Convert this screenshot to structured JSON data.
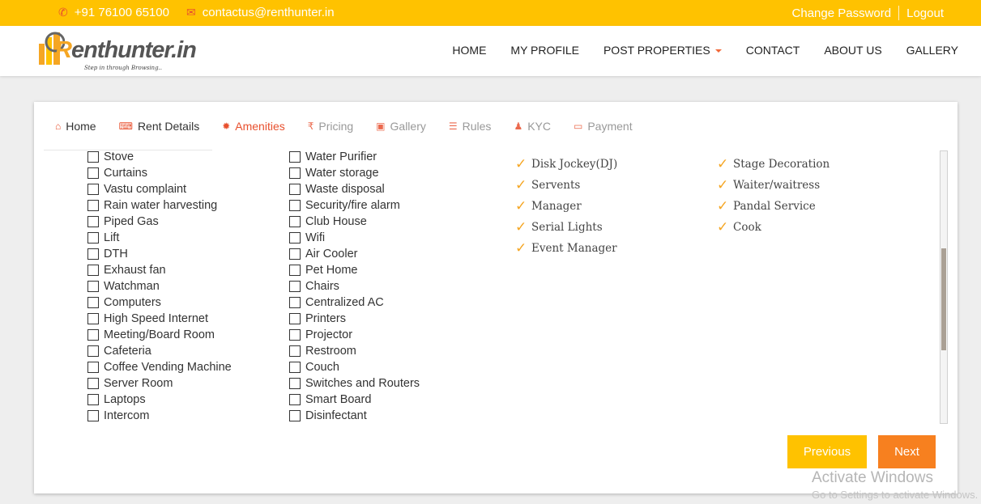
{
  "topbar": {
    "phone": "+91 76100 65100",
    "email": "contactus@renthunter.in",
    "change_password": "Change Password",
    "logout": "Logout",
    "phone_icon": "phone-icon",
    "email_icon": "envelope-icon"
  },
  "logo": {
    "r": "R",
    "text": "enthunter.in",
    "tagline": "Step in through Browsing.."
  },
  "nav": {
    "home": "HOME",
    "my_profile": "MY PROFILE",
    "post_properties": "POST PROPERTIES",
    "contact": "CONTACT",
    "about_us": "ABOUT US",
    "gallery": "GALLERY"
  },
  "tabs": [
    {
      "label": "Home",
      "icon": "home-icon",
      "glyph": "⌂"
    },
    {
      "label": "Rent Details",
      "icon": "keyboard-icon",
      "glyph": "⌨"
    },
    {
      "label": "Amenities",
      "icon": "asterisk-icon",
      "glyph": "✹"
    },
    {
      "label": "Pricing",
      "icon": "rupee-icon",
      "glyph": "₹"
    },
    {
      "label": "Gallery",
      "icon": "image-icon",
      "glyph": "▣"
    },
    {
      "label": "Rules",
      "icon": "list-icon",
      "glyph": "☰"
    },
    {
      "label": "KYC",
      "icon": "user-icon",
      "glyph": "♟"
    },
    {
      "label": "Payment",
      "icon": "money-icon",
      "glyph": "▭"
    }
  ],
  "amenities_col1": [
    "Stove",
    "Curtains",
    "Vastu complaint",
    "Rain water harvesting",
    "Piped Gas",
    "Lift",
    "DTH",
    "Exhaust fan",
    "Watchman",
    "Computers",
    "High Speed Internet",
    "Meeting/Board Room",
    "Cafeteria",
    "Coffee Vending Machine",
    "Server Room",
    "Laptops",
    "Intercom"
  ],
  "amenities_col2": [
    "Water Purifier",
    "Water storage",
    "Waste disposal",
    "Security/fire alarm",
    "Club House",
    "Wifi",
    "Air Cooler",
    "Pet Home",
    "Chairs",
    "Centralized AC",
    "Printers",
    "Projector",
    "Restroom",
    "Couch",
    "Switches and Routers",
    "Smart Board",
    "Disinfectant"
  ],
  "services_col1": [
    "Disk Jockey(DJ)",
    "Servents",
    "Manager",
    "Serial Lights",
    "Event Manager"
  ],
  "services_col2": [
    "Stage Decoration",
    "Waiter/waitress",
    "Pandal Service",
    "Cook"
  ],
  "buttons": {
    "previous": "Previous",
    "next": "Next"
  },
  "watermark": {
    "line1": "Activate Windows",
    "line2": "Go to Settings to activate Windows."
  },
  "colors": {
    "topbar": "#ffc200",
    "accent": "#e8502e",
    "next": "#f7801f"
  }
}
